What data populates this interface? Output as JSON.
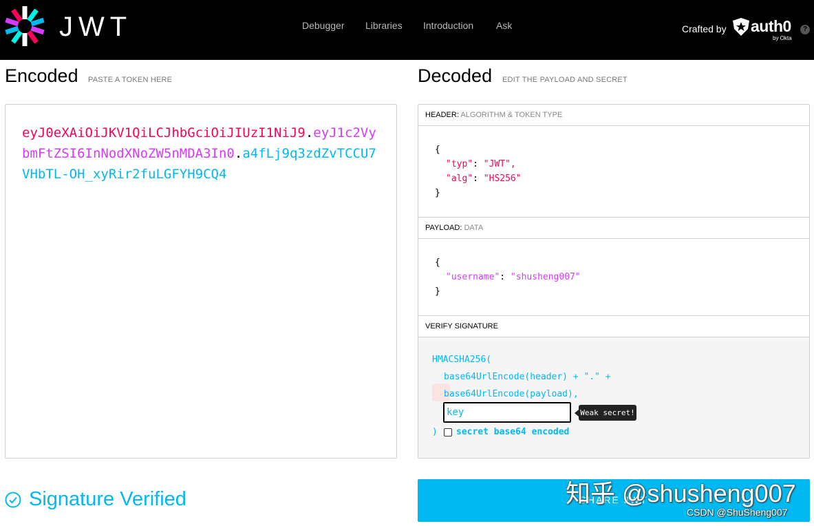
{
  "header": {
    "brand": "JWT",
    "nav": [
      "Debugger",
      "Libraries",
      "Introduction",
      "Ask"
    ],
    "crafted_by": "Crafted by",
    "auth0_brand": "auth0",
    "auth0_sub": "by Okta",
    "help_icon": "?"
  },
  "encoded": {
    "title": "Encoded",
    "subtitle": "PASTE A TOKEN HERE",
    "token_header": "eyJ0eXAiOiJKV1QiLCJhbGciOiJIUzI1NiJ9",
    "token_payload": "eyJ1c2VybmFtZSI6InNodXNoZW5nMDA3In0",
    "token_signature": "a4fLj9q3zdZvTCCU7VHbTL-OH_xyRir2fuLGFYH9CQ4",
    "dot": "."
  },
  "decoded": {
    "title": "Decoded",
    "subtitle": "EDIT THE PAYLOAD AND SECRET",
    "header_section": {
      "label": "HEADER:",
      "sublabel": "ALGORITHM & TOKEN TYPE",
      "open": "{",
      "typ_key": "\"typ\"",
      "typ_value": "\"JWT\",",
      "alg_key": "\"alg\"",
      "alg_value": "\"HS256\"",
      "colon": ": ",
      "close": "}"
    },
    "payload_section": {
      "label": "PAYLOAD:",
      "sublabel": "DATA",
      "open": "{",
      "username_key": "\"username\"",
      "username_value": "\"shusheng007\"",
      "colon": ": ",
      "close": "}"
    },
    "verify_section": {
      "label": "VERIFY SIGNATURE",
      "fn_open": "HMACSHA256(",
      "line1": "base64UrlEncode(header) + \".\" +",
      "line2": "base64UrlEncode(payload),",
      "secret_value": "key",
      "weak_tooltip": "Weak secret!",
      "close": ")",
      "checkbox_label": "secret base64 encoded",
      "checkbox_checked": false
    }
  },
  "footer": {
    "status": "Signature Verified",
    "share_label": "SHARE JWT",
    "watermark": "知乎 @shusheng007",
    "watermark2": "CSDN @ShuSheng007"
  },
  "colors": {
    "header_bg": "#000000",
    "header_red": "#fb015b",
    "payload_purple": "#d63aff",
    "signature_blue": "#00b9f1"
  }
}
